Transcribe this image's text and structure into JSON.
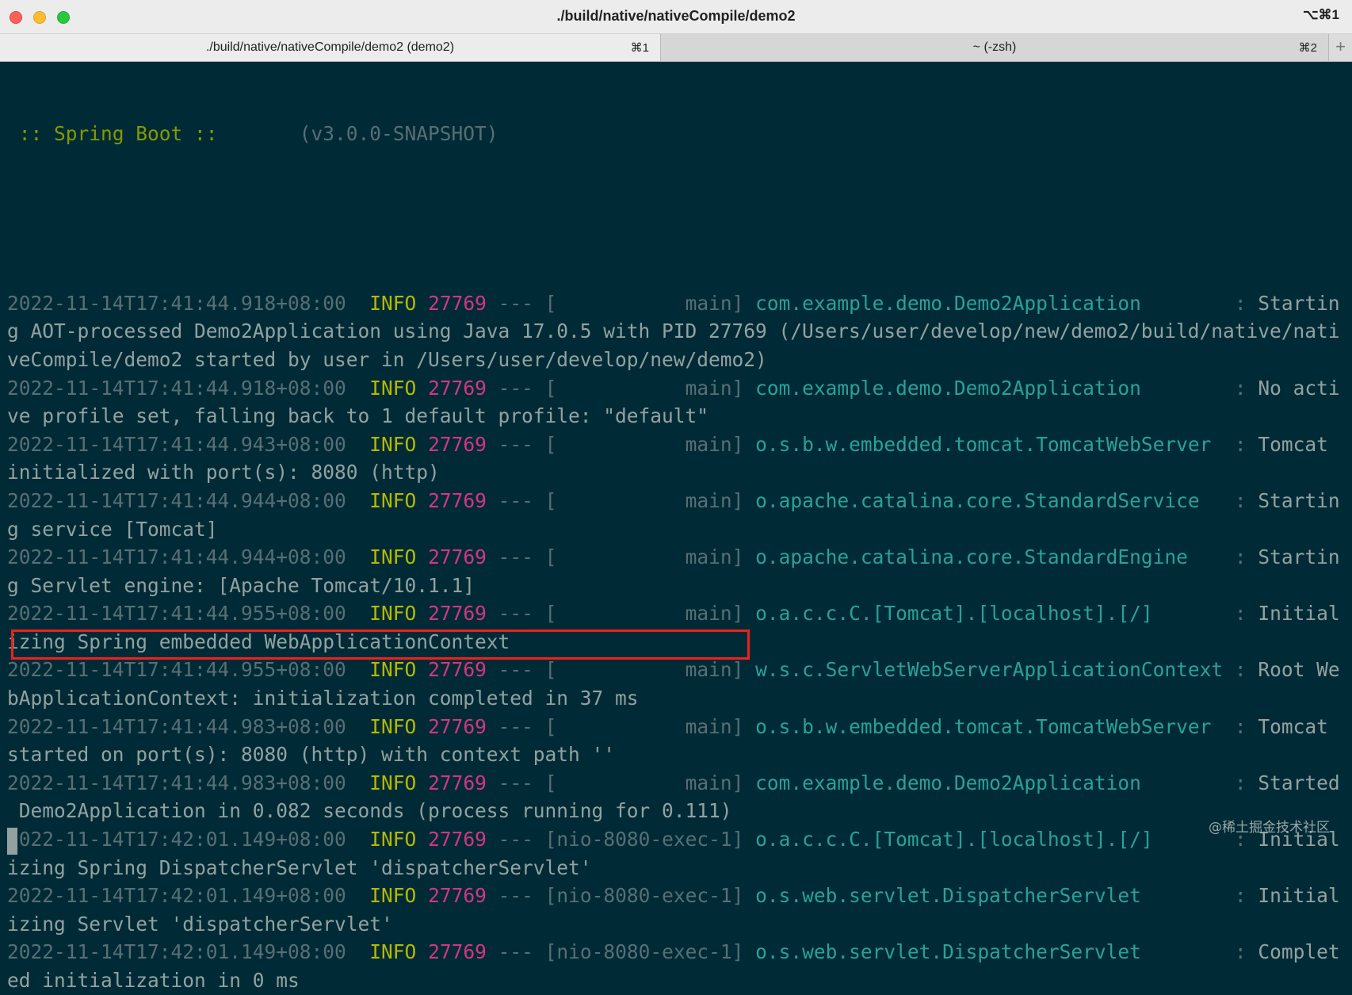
{
  "window": {
    "title": "./build/native/nativeCompile/demo2",
    "shortcut": "⌥⌘1"
  },
  "tabs": [
    {
      "label": "./build/native/nativeCompile/demo2 (demo2)",
      "key": "⌘1",
      "active": true
    },
    {
      "label": "~ (-zsh)",
      "key": "⌘2",
      "active": false
    }
  ],
  "tab_add_label": "+",
  "banner": {
    "name": " :: Spring Boot :: ",
    "version": "      (v3.0.0-SNAPSHOT)"
  },
  "log": [
    {
      "ts": "2022-11-14T17:41:44.918+08:00",
      "level": "INFO",
      "pid": "27769",
      "sep": " --- [",
      "thread": "           main]",
      "logger": "com.example.demo.Demo2Application",
      "pad": "        : ",
      "msg_head": "Startin",
      "msg_tail": "g AOT-processed Demo2Application using Java 17.0.5 with PID 27769 (/Users/user/develop/new/demo2/build/native/nati",
      "msg_tail2": "veCompile/demo2 started by user in /Users/user/develop/new/demo2)"
    },
    {
      "ts": "2022-11-14T17:41:44.918+08:00",
      "level": "INFO",
      "pid": "27769",
      "sep": " --- [",
      "thread": "           main]",
      "logger": "com.example.demo.Demo2Application",
      "pad": "        : ",
      "msg_head": "No acti",
      "msg_tail": "ve profile set, falling back to 1 default profile: \"default\""
    },
    {
      "ts": "2022-11-14T17:41:44.943+08:00",
      "level": "INFO",
      "pid": "27769",
      "sep": " --- [",
      "thread": "           main]",
      "logger": "o.s.b.w.embedded.tomcat.TomcatWebServer",
      "pad": "  : ",
      "msg_head": "Tomcat ",
      "msg_tail": "initialized with port(s): 8080 (http)"
    },
    {
      "ts": "2022-11-14T17:41:44.944+08:00",
      "level": "INFO",
      "pid": "27769",
      "sep": " --- [",
      "thread": "           main]",
      "logger": "o.apache.catalina.core.StandardService",
      "pad": "   : ",
      "msg_head": "Startin",
      "msg_tail": "g service [Tomcat]"
    },
    {
      "ts": "2022-11-14T17:41:44.944+08:00",
      "level": "INFO",
      "pid": "27769",
      "sep": " --- [",
      "thread": "           main]",
      "logger": "o.apache.catalina.core.StandardEngine",
      "pad": "    : ",
      "msg_head": "Startin",
      "msg_tail": "g Servlet engine: [Apache Tomcat/10.1.1]"
    },
    {
      "ts": "2022-11-14T17:41:44.955+08:00",
      "level": "INFO",
      "pid": "27769",
      "sep": " --- [",
      "thread": "           main]",
      "logger": "o.a.c.c.C.[Tomcat].[localhost].[/]",
      "pad": "       : ",
      "msg_head": "Initial",
      "msg_tail": "izing Spring embedded WebApplicationContext"
    },
    {
      "ts": "2022-11-14T17:41:44.955+08:00",
      "level": "INFO",
      "pid": "27769",
      "sep": " --- [",
      "thread": "           main]",
      "logger": "w.s.c.ServletWebServerApplicationContext",
      "pad": " : ",
      "msg_head": "Root We",
      "msg_tail": "bApplicationContext: initialization completed in 37 ms"
    },
    {
      "ts": "2022-11-14T17:41:44.983+08:00",
      "level": "INFO",
      "pid": "27769",
      "sep": " --- [",
      "thread": "           main]",
      "logger": "o.s.b.w.embedded.tomcat.TomcatWebServer",
      "pad": "  : ",
      "msg_head": "Tomcat ",
      "msg_tail": "started on port(s): 8080 (http) with context path ''"
    },
    {
      "ts": "2022-11-14T17:41:44.983+08:00",
      "level": "INFO",
      "pid": "27769",
      "sep": " --- [",
      "thread": "           main]",
      "logger": "com.example.demo.Demo2Application",
      "pad": "        : ",
      "msg_head": "Started",
      "msg_tail": " Demo2Application in 0.082 seconds (process running for 0.111)"
    },
    {
      "ts": "2022-11-14T17:42:01.149+08:00",
      "level": "INFO",
      "pid": "27769",
      "sep": " --- [",
      "thread": "nio-8080-exec-1]",
      "logger": "o.a.c.c.C.[Tomcat].[localhost].[/]",
      "pad": "       : ",
      "msg_head": "Initial",
      "msg_tail": "izing Spring DispatcherServlet 'dispatcherServlet'"
    },
    {
      "ts": "2022-11-14T17:42:01.149+08:00",
      "level": "INFO",
      "pid": "27769",
      "sep": " --- [",
      "thread": "nio-8080-exec-1]",
      "logger": "o.s.web.servlet.DispatcherServlet",
      "pad": "        : ",
      "msg_head": "Initial",
      "msg_tail": "izing Servlet 'dispatcherServlet'"
    },
    {
      "ts": "2022-11-14T17:42:01.149+08:00",
      "level": "INFO",
      "pid": "27769",
      "sep": " --- [",
      "thread": "nio-8080-exec-1]",
      "logger": "o.s.web.servlet.DispatcherServlet",
      "pad": "        : ",
      "msg_head": "Complet",
      "msg_tail": "ed initialization in 0 ms"
    }
  ],
  "watermark": "@稀土掘金技术社区",
  "colors": {
    "background": "#002b36",
    "timestamp": "#586e75",
    "level": "#b7b800",
    "pid": "#d33682",
    "logger": "#2aa198",
    "highlight": "#e8231f"
  }
}
